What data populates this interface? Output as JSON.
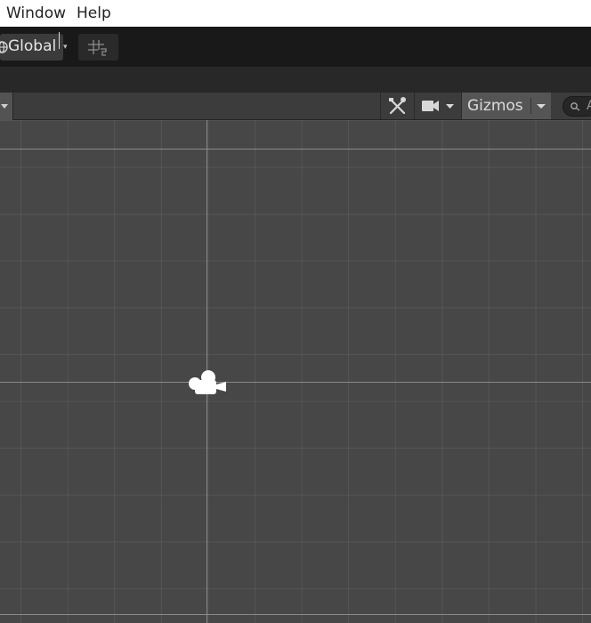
{
  "menu": {
    "items": [
      "Window",
      "Help"
    ]
  },
  "toolbar": {
    "pivot_rotation_label": "Global"
  },
  "scene_toolbar": {
    "gizmos_label": "Gizmos",
    "search_text": "A"
  },
  "icons": {
    "globe": "globe-icon",
    "grid_snap": "grid-snap-icon",
    "tools": "tools-icon",
    "camera": "video-camera-icon",
    "dropdown": "chevron-down-icon",
    "search": "search-icon",
    "scene_camera": "scene-camera-icon"
  },
  "colors": {
    "viewport_bg": "#474747",
    "toolbar_bg": "#191919",
    "menubar_bg": "#ffffff"
  }
}
